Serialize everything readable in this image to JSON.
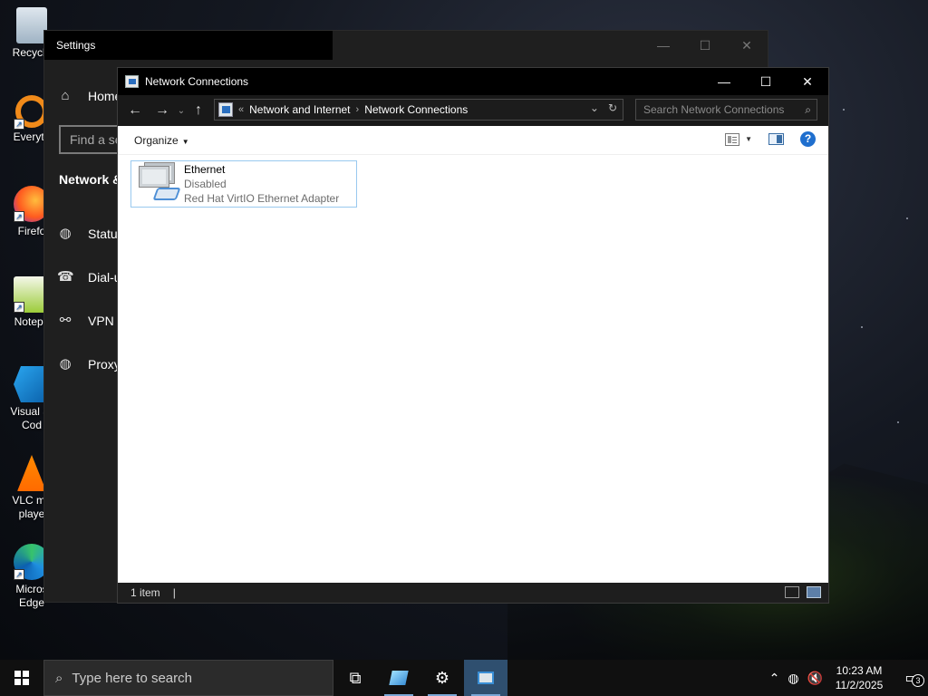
{
  "desktop": {
    "icons": [
      {
        "label": "Recycle",
        "icon": "recycle-bin-icon"
      },
      {
        "label": "Everyth",
        "icon": "everything-search-icon"
      },
      {
        "label": "Firefo",
        "icon": "firefox-icon"
      },
      {
        "label": "Notepa",
        "icon": "notepad-plus-plus-icon"
      },
      {
        "label": "Visual St\nCod",
        "icon": "vscode-icon"
      },
      {
        "label": "VLC me\nplaye",
        "icon": "vlc-icon"
      },
      {
        "label": "Micros\nEdge",
        "icon": "edge-icon"
      }
    ]
  },
  "settings": {
    "title": "Settings",
    "home": "Home",
    "search_placeholder": "Find a se",
    "section": "Network &",
    "nav": [
      {
        "label": "Status",
        "icon": "globe-icon"
      },
      {
        "label": "Dial-u",
        "icon": "dialup-icon"
      },
      {
        "label": "VPN",
        "icon": "vpn-icon"
      },
      {
        "label": "Proxy",
        "icon": "globe-icon"
      }
    ]
  },
  "explorer": {
    "title": "Network Connections",
    "address": {
      "prefix": "«",
      "crumbs": [
        "Network and Internet",
        "Network Connections"
      ]
    },
    "search_placeholder": "Search Network Connections",
    "command_bar": {
      "organize": "Organize"
    },
    "items": [
      {
        "name": "Ethernet",
        "status": "Disabled",
        "device": "Red Hat VirtIO Ethernet Adapter"
      }
    ],
    "status": {
      "count": "1 item"
    }
  },
  "taskbar": {
    "search_placeholder": "Type here to search",
    "clock": {
      "time": "10:23 AM",
      "date": "11/2/2025"
    },
    "notifications_count": "3"
  },
  "colors": {
    "selection_border": "#99c9ef",
    "accent": "#1f6fce",
    "taskbar": "#101010",
    "titlebar": "#000000"
  }
}
